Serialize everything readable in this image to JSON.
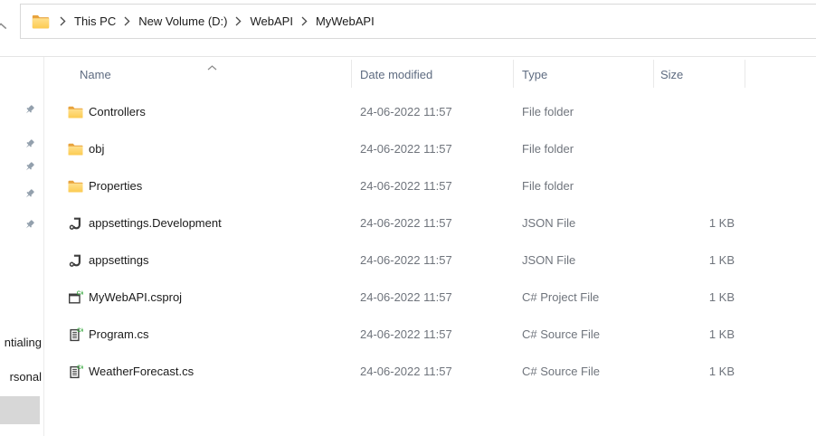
{
  "address_bar": {
    "icon": "folder-icon",
    "breadcrumb": [
      {
        "label": "This PC"
      },
      {
        "label": "New Volume (D:)"
      },
      {
        "label": "WebAPI"
      },
      {
        "label": "MyWebAPI"
      }
    ]
  },
  "columns": [
    {
      "label": "Name",
      "sort": "ascending",
      "sort_icon": "sort-ascending-caret-icon"
    },
    {
      "label": "Date modified"
    },
    {
      "label": "Type"
    },
    {
      "label": "Size"
    }
  ],
  "files": [
    {
      "name": "Controllers",
      "icon": "folder-icon",
      "date": "24-06-2022 11:57",
      "type": "File folder",
      "size": ""
    },
    {
      "name": "obj",
      "icon": "folder-icon",
      "date": "24-06-2022 11:57",
      "type": "File folder",
      "size": ""
    },
    {
      "name": "Properties",
      "icon": "folder-icon",
      "date": "24-06-2022 11:57",
      "type": "File folder",
      "size": ""
    },
    {
      "name": "appsettings.Development",
      "icon": "json-icon",
      "date": "24-06-2022 11:57",
      "type": "JSON File",
      "size": "1 KB"
    },
    {
      "name": "appsettings",
      "icon": "json-icon",
      "date": "24-06-2022 11:57",
      "type": "JSON File",
      "size": "1 KB"
    },
    {
      "name": "MyWebAPI.csproj",
      "icon": "csproj-icon",
      "date": "24-06-2022 11:57",
      "type": "C# Project File",
      "size": "1 KB"
    },
    {
      "name": "Program.cs",
      "icon": "cs-icon",
      "date": "24-06-2022 11:57",
      "type": "C# Source File",
      "size": "1 KB"
    },
    {
      "name": "WeatherForecast.cs",
      "icon": "cs-icon",
      "date": "24-06-2022 11:57",
      "type": "C# Source File",
      "size": "1 KB"
    }
  ],
  "nav_pane": {
    "pins": [
      "pin-icon",
      "pin-icon",
      "pin-icon",
      "pin-icon",
      "pin-icon"
    ],
    "truncated_labels": [
      "ntialing",
      "rsonal"
    ]
  },
  "colors": {
    "folder_back": "#e8a33d",
    "folder_front_top": "#ffe08d",
    "folder_front_bottom": "#fccb51",
    "csharp_green": "#3fab45",
    "icon_dark": "#3e3e3e",
    "header_text": "#5e6b80",
    "primary_text": "#1b1b1b",
    "secondary_text": "#6f747c",
    "pin_gray": "#93a0ad",
    "border_gray": "#d9d9d9",
    "highlight_gray": "#d7d7d7"
  }
}
